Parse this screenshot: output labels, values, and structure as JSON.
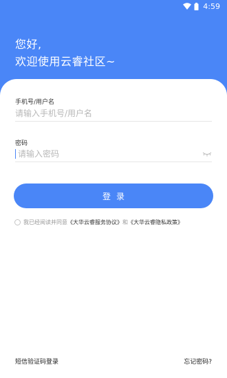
{
  "status_bar": {
    "time": "4:59",
    "icons": [
      "wifi-icon",
      "battery-icon"
    ]
  },
  "greeting": {
    "line1": "您好,",
    "line2": "欢迎使用云睿社区~"
  },
  "form": {
    "username_label": "手机号/用户名",
    "username_placeholder": "请输入手机号/用户名",
    "password_label": "密码",
    "password_placeholder": "请输入密码"
  },
  "login_button_label": "登录",
  "agreement": {
    "prefix": "我已经阅读并同意",
    "service_agreement": "《大华云睿服务协议》",
    "and": "和",
    "privacy_policy": "《大华云睿隐私政策》"
  },
  "footer": {
    "sms_login": "短信验证码登录",
    "forgot_password": "忘记密码?"
  },
  "colors": {
    "primary": "#4a86f7",
    "text": "#333333",
    "placeholder": "#b8b8b8"
  }
}
